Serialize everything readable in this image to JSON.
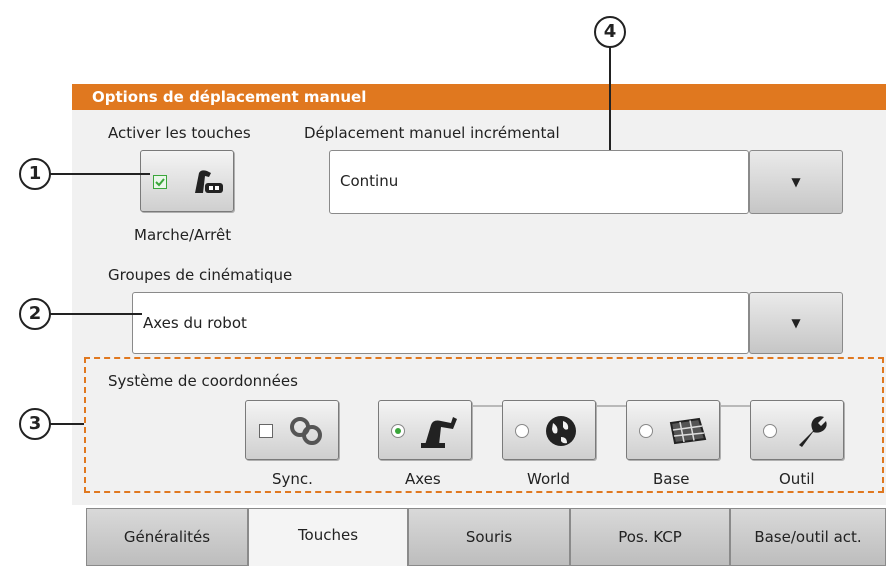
{
  "panel": {
    "title": "Options de déplacement manuel",
    "activate_keys_label": "Activer les touches",
    "on_off_label": "Marche/Arrêt",
    "incremental_label": "Déplacement manuel incrémental",
    "incremental_value": "Continu",
    "kinematics_label": "Groupes de cinématique",
    "kinematics_value": "Axes du robot",
    "coords_label": "Système de coordonnées",
    "coord_buttons": [
      "Sync.",
      "Axes",
      "World",
      "Base",
      "Outil"
    ],
    "selected_coord": "Axes"
  },
  "callouts": [
    "1",
    "2",
    "3",
    "4"
  ],
  "tabs": [
    "Généralités",
    "Touches",
    "Souris",
    "Pos. KCP",
    "Base/outil act."
  ],
  "active_tab": "Touches",
  "colors": {
    "accent": "#e0781f",
    "check": "#3aa63a"
  }
}
